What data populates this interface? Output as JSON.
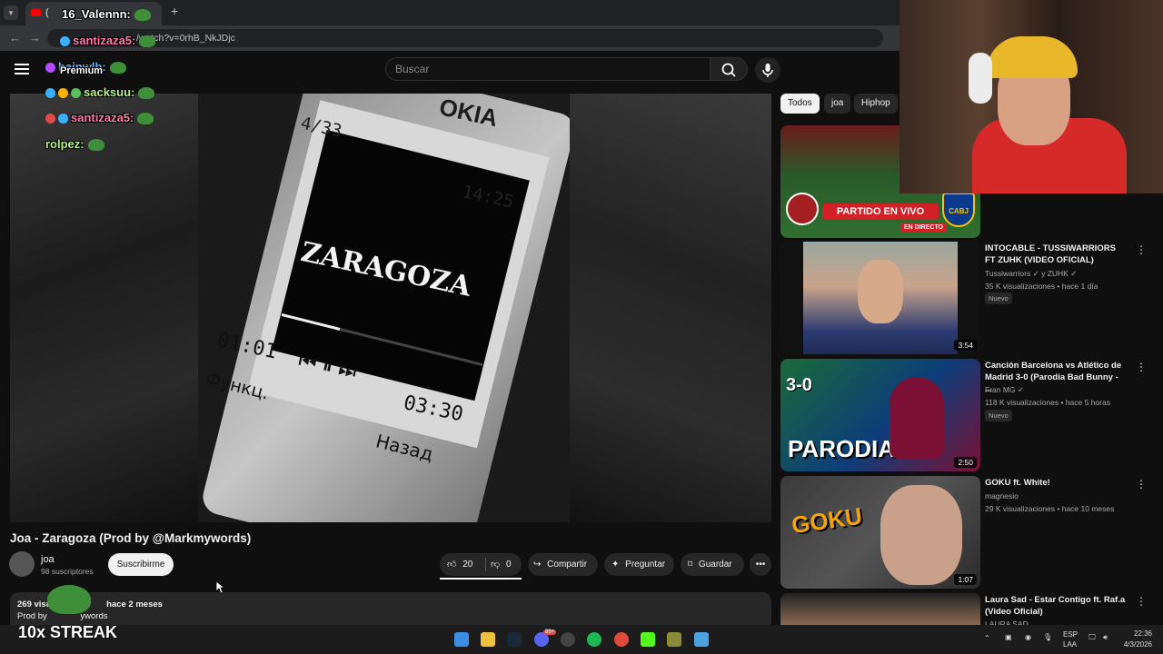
{
  "browser": {
    "tab_title": "(",
    "new_tab_symbol": "+",
    "url": "/watch?v=0rhB_NkJDjc"
  },
  "youtube": {
    "search_placeholder": "Buscar",
    "premium_label": "Premium"
  },
  "video": {
    "title": "Joa - Zaragoza (Prod by @Markmywords)",
    "channel_name": "joa",
    "subscribers": "98 suscriptores",
    "subscribe_label": "Suscribirme",
    "likes": "20",
    "dislikes": "0",
    "share_label": "Compartir",
    "ask_label": "Preguntar",
    "save_label": "Guardar",
    "views_prefix": "269 visu",
    "date": "hace 2 meses",
    "desc_prefix": "Prod by",
    "desc_suffix": "ywords",
    "screen": {
      "counter": "4/33",
      "clock": "14:25",
      "track": "ZARAGOZA",
      "elapsed": "01:01",
      "total": "03:30",
      "left_key": "Функц.",
      "right_key": "Назад",
      "brand": "OKIA",
      "progress": 0.29
    }
  },
  "sidebar": {
    "chips": [
      "Todos",
      "joa",
      "Hiphop"
    ],
    "live_card": {
      "banner": "PARTIDO EN VIVO",
      "live_badge": "EN DIRECTO",
      "team_right": "CABJ"
    },
    "videos": [
      {
        "title": "INTOCABLE - TUSSIWARRIORS FT ZUHK (VIDEO OFICIAL)",
        "channel": "Tussiwarriors",
        "channel_extra": "y ZUHK",
        "meta": "35 K visualizaciones • hace 1 día",
        "badge": "Nuevo",
        "duration": "3:54"
      },
      {
        "title": "Canción Barcelona vs Atlético de Madrid 3-0 (Parodia Bad Bunny - ...",
        "channel": "Fran MG",
        "meta": "118 K visualizaciones • hace 5 horas",
        "badge": "Nuevo",
        "duration": "2:50",
        "thumb_score": "3-0",
        "thumb_text": "PARODIA"
      },
      {
        "title": "GOKU ft. White!",
        "channel": "magnesio",
        "meta": "29 K visualizaciones • hace 10 meses",
        "duration": "1:07",
        "thumb_text": "GOKU"
      },
      {
        "title": "Laura Sad - Estar Contigo ft. Raf.a (Video Oficial)",
        "channel": "LAURA SAD"
      }
    ]
  },
  "chat": [
    {
      "user": "16_Valennn:"
    },
    {
      "user": "santizaza5:"
    },
    {
      "user": "bainwlb:"
    },
    {
      "user": "sacksuu:"
    },
    {
      "user": "santizaza5:"
    },
    {
      "user": "rolpez:"
    }
  ],
  "overlay": {
    "streak": "10x STREAK"
  },
  "taskbar": {
    "lang": "ESP",
    "region": "LAA",
    "time": "22:36",
    "date": "4/3/2026",
    "notification_count": "99+"
  },
  "colors": {
    "chat_user_1": "#ffffff",
    "chat_user_pink": "#ff7aa8",
    "chat_user_blue": "#6ab0ff",
    "chat_user_green": "#b6f08a",
    "live_red": "#d32027",
    "boca_blue": "#0b3a8c",
    "boca_yellow": "#f5c400"
  }
}
